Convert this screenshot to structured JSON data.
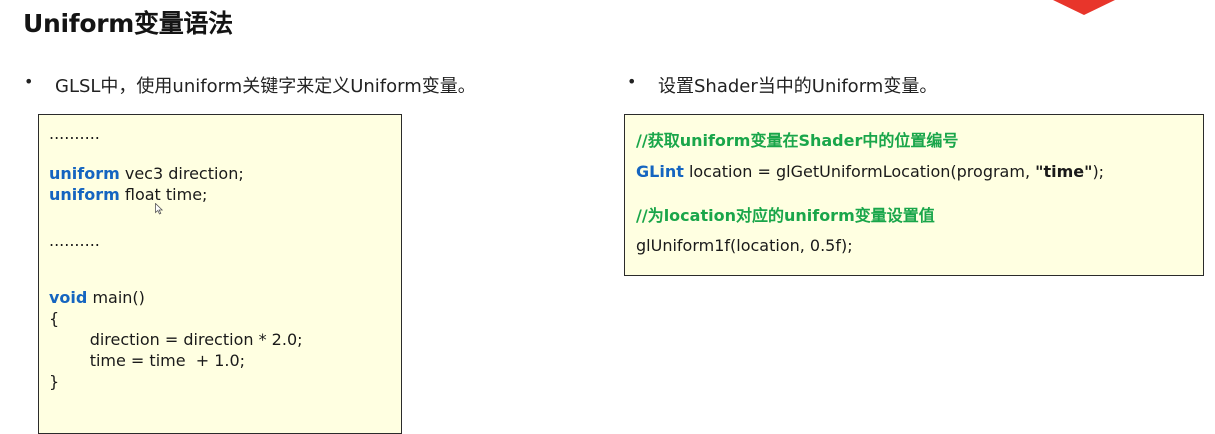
{
  "slide": {
    "title": "Uniform变量语法"
  },
  "bullets": {
    "left": {
      "marker": "•",
      "text": "GLSL中，使用uniform关键字来定义Uniform变量。"
    },
    "right": {
      "marker": "•",
      "text": "设置Shader当中的Uniform变量。"
    }
  },
  "left_code": {
    "dots_top": "..........",
    "decl1": {
      "keyword": "uniform",
      "rest": " vec3 direction;"
    },
    "decl2": {
      "keyword": "uniform",
      "rest": " float time;"
    },
    "dots_mid": "..........",
    "main_sig": {
      "keyword": "void",
      "rest": " main()"
    },
    "brace_open": "{",
    "stmt1": "        direction = direction * 2.0;",
    "stmt2": "        time = time  + 1.0;",
    "brace_close": "}"
  },
  "right_code": {
    "comment1": "//获取uniform变量在Shader中的位置编号",
    "line1": {
      "type": "GLint",
      "pre": " location = glGetUniformLocation(program, ",
      "str": "\"time\"",
      "post": ");"
    },
    "comment2": "//为location对应的uniform变量设置值",
    "line2": "glUniform1f(location, 0.5f);"
  },
  "colors": {
    "keyword": "#1565c0",
    "comment": "#1aa64a",
    "code_box_bg": "#ffffe1",
    "accent": "#e8352b"
  },
  "icons": {
    "corner": "red-triangle-decoration",
    "cursor": "mouse-pointer-icon"
  }
}
